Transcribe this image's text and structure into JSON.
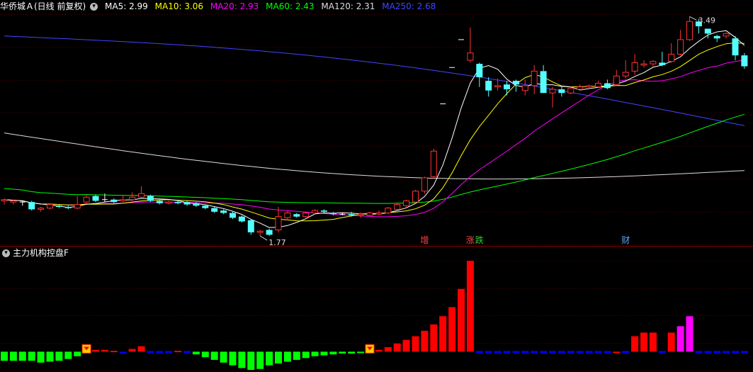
{
  "header": {
    "title": "华侨城Ａ(日线 前复权)",
    "ma": [
      {
        "label": "MA5: 2.99",
        "color": "#ffffff"
      },
      {
        "label": "MA10: 3.06",
        "color": "#ffff00"
      },
      {
        "label": "MA20: 2.93",
        "color": "#ff00ff"
      },
      {
        "label": "MA60: 2.43",
        "color": "#00ff00"
      },
      {
        "label": "MA120: 2.31",
        "color": "#dddddd"
      },
      {
        "label": "MA250: 2.68",
        "color": "#4444ff"
      }
    ]
  },
  "indicator": {
    "title": "主力机构控盘F"
  },
  "annotations": {
    "high_label": "3.49",
    "low_label": "1.77",
    "markers": [
      {
        "text": "增",
        "color": "#ff4444",
        "index": 46
      },
      {
        "text": "涨",
        "color": "#ff4444",
        "index": 51
      },
      {
        "text": "跌",
        "color": "#33cc33",
        "index": 52
      },
      {
        "text": "财",
        "color": "#55aaff",
        "index": 68
      }
    ]
  },
  "colors": {
    "up": "#ff3232",
    "down": "#54ffff",
    "flat": "#ffffff",
    "ma5": "#ffffff",
    "ma10": "#ffff00",
    "ma20": "#ff00ff",
    "ma60": "#00ff00",
    "ma120": "#dddddd",
    "ma250": "#4444ff",
    "bar_green": "#00ff00",
    "bar_red": "#ff0000",
    "bar_blue": "#0000ff",
    "bar_magenta": "#ff00ff",
    "grid": "#5a0000"
  },
  "chart_data": {
    "type": "candlestick",
    "price_range": [
      1.7,
      3.6
    ],
    "candles": [
      [
        2.06,
        2.07,
        2.03,
        2.08
      ],
      [
        2.05,
        2.06,
        2.03,
        2.07
      ],
      [
        2.05,
        2.05,
        2.02,
        2.06
      ],
      [
        2.05,
        1.99,
        1.98,
        2.06
      ],
      [
        1.99,
        2.0,
        1.97,
        2.01
      ],
      [
        2.0,
        2.03,
        1.99,
        2.04
      ],
      [
        2.02,
        2.01,
        2.0,
        2.03
      ],
      [
        2.01,
        2.0,
        1.99,
        2.02
      ],
      [
        2.0,
        2.03,
        1.99,
        2.1
      ],
      [
        2.05,
        2.09,
        2.04,
        2.11
      ],
      [
        2.1,
        2.06,
        2.05,
        2.11
      ],
      [
        2.07,
        2.07,
        2.05,
        2.12
      ],
      [
        2.07,
        2.05,
        2.04,
        2.08
      ],
      [
        2.06,
        2.07,
        2.05,
        2.11
      ],
      [
        2.07,
        2.09,
        2.06,
        2.13
      ],
      [
        2.09,
        2.12,
        2.08,
        2.18
      ],
      [
        2.1,
        2.06,
        2.05,
        2.11
      ],
      [
        2.06,
        2.04,
        2.03,
        2.07
      ],
      [
        2.04,
        2.05,
        2.03,
        2.06
      ],
      [
        2.05,
        2.04,
        2.03,
        2.07
      ],
      [
        2.05,
        2.03,
        2.02,
        2.06
      ],
      [
        2.04,
        2.02,
        2.01,
        2.05
      ],
      [
        2.02,
        2.0,
        1.99,
        2.03
      ],
      [
        2.0,
        1.97,
        1.96,
        2.01
      ],
      [
        1.98,
        1.96,
        1.95,
        1.99
      ],
      [
        1.96,
        1.92,
        1.91,
        1.97
      ],
      [
        1.93,
        1.89,
        1.88,
        1.94
      ],
      [
        1.9,
        1.8,
        1.78,
        1.91
      ],
      [
        1.8,
        1.81,
        1.77,
        1.82
      ],
      [
        1.82,
        1.78,
        1.77,
        1.83
      ],
      [
        1.82,
        1.93,
        1.8,
        2.01
      ],
      [
        1.92,
        1.96,
        1.9,
        1.98
      ],
      [
        1.95,
        1.93,
        1.92,
        1.96
      ],
      [
        1.93,
        1.96,
        1.92,
        1.97
      ],
      [
        1.96,
        1.98,
        1.95,
        1.99
      ],
      [
        1.98,
        1.97,
        1.96,
        1.99
      ],
      [
        1.96,
        1.95,
        1.94,
        1.97
      ],
      [
        1.95,
        1.95,
        1.94,
        1.96
      ],
      [
        1.95,
        1.94,
        1.93,
        1.97
      ],
      [
        1.94,
        1.95,
        1.92,
        1.96
      ],
      [
        1.94,
        1.96,
        1.93,
        1.97
      ],
      [
        1.95,
        1.96,
        1.94,
        1.98
      ],
      [
        1.96,
        2.0,
        1.95,
        2.01
      ],
      [
        1.99,
        2.03,
        1.98,
        2.04
      ],
      [
        2.02,
        2.06,
        2.01,
        2.07
      ],
      [
        2.05,
        2.14,
        2.04,
        2.15
      ],
      [
        2.14,
        2.25,
        2.12,
        2.26
      ],
      [
        2.26,
        2.47,
        2.24,
        2.49
      ],
      [
        2.86,
        2.86,
        2.86,
        2.86
      ],
      [
        3.16,
        3.16,
        3.16,
        3.16
      ],
      [
        3.39,
        3.39,
        3.39,
        3.39
      ],
      [
        3.22,
        3.28,
        3.2,
        3.49
      ],
      [
        3.19,
        3.08,
        3.0,
        3.2
      ],
      [
        3.05,
        2.97,
        2.92,
        3.08
      ],
      [
        3.0,
        3.01,
        2.97,
        3.07
      ],
      [
        3.02,
        2.98,
        2.93,
        3.05
      ],
      [
        3.05,
        3.02,
        2.96,
        3.06
      ],
      [
        2.97,
        3.01,
        2.93,
        3.06
      ],
      [
        3.01,
        3.13,
        2.94,
        3.18
      ],
      [
        3.13,
        2.95,
        2.95,
        3.18
      ],
      [
        2.95,
        2.98,
        2.83,
        3.0
      ],
      [
        2.98,
        2.95,
        2.92,
        3.01
      ],
      [
        2.95,
        2.99,
        2.94,
        3.0
      ],
      [
        2.98,
        3.0,
        2.97,
        3.02
      ],
      [
        3.0,
        3.01,
        2.98,
        3.02
      ],
      [
        3.0,
        3.03,
        2.99,
        3.05
      ],
      [
        3.03,
        2.99,
        2.98,
        3.06
      ],
      [
        3.02,
        3.09,
        3.01,
        3.14
      ],
      [
        3.09,
        3.12,
        3.07,
        3.22
      ],
      [
        3.13,
        3.2,
        3.1,
        3.27
      ],
      [
        3.18,
        3.19,
        3.16,
        3.22
      ],
      [
        3.19,
        3.21,
        3.17,
        3.22
      ],
      [
        3.2,
        3.18,
        3.17,
        3.29
      ],
      [
        3.21,
        3.27,
        3.2,
        3.36
      ],
      [
        3.27,
        3.39,
        3.26,
        3.47
      ],
      [
        3.39,
        3.54,
        3.38,
        3.58
      ],
      [
        3.54,
        3.5,
        3.44,
        3.56
      ],
      [
        3.48,
        3.44,
        3.4,
        3.47
      ],
      [
        3.42,
        3.4,
        3.37,
        3.43
      ],
      [
        3.42,
        3.44,
        3.4,
        3.45
      ],
      [
        3.4,
        3.26,
        3.22,
        3.42
      ],
      [
        3.26,
        3.17,
        3.15,
        3.28
      ]
    ],
    "ma_start_values": {
      "ma120": 2.62,
      "ma250": 3.42
    },
    "ma_end_values": {
      "ma5": 2.99,
      "ma10": 3.06,
      "ma20": 2.93,
      "ma60": 2.43,
      "ma120": 2.31,
      "ma250": 2.68
    },
    "indicator_range": [
      -2.0,
      10.0
    ],
    "indicator_values": [
      -1.0,
      -1.0,
      -1.0,
      -1.0,
      -1.2,
      -1.1,
      -1.0,
      -0.8,
      -0.5,
      0.2,
      0.2,
      0.2,
      0.1,
      -0.2,
      0.3,
      0.6,
      0,
      0,
      0,
      0.1,
      -0.1,
      -0.3,
      -0.6,
      -0.9,
      -1.2,
      -1.5,
      -1.8,
      -2.0,
      -1.9,
      -1.5,
      -1.3,
      -1.1,
      -0.9,
      -0.7,
      -0.5,
      -0.4,
      -0.3,
      -0.2,
      -0.2,
      -0.1,
      0.1,
      0.2,
      0.5,
      0.9,
      1.3,
      1.7,
      2.3,
      3.0,
      3.9,
      4.9,
      6.9,
      10.0,
      0,
      0,
      0,
      0,
      0,
      0,
      0,
      0,
      0,
      0,
      0,
      0,
      0,
      0,
      0,
      0,
      0,
      1.7,
      2.1,
      2.1,
      0,
      2.1,
      2.8,
      3.9,
      0,
      0,
      0,
      0,
      0,
      0
    ],
    "indicator_colors": [
      "g",
      "g",
      "g",
      "g",
      "g",
      "g",
      "g",
      "g",
      "g",
      "r",
      "r",
      "r",
      "r",
      "b",
      "r",
      "r",
      "b",
      "b",
      "b",
      "r",
      "b",
      "g",
      "g",
      "g",
      "g",
      "g",
      "g",
      "g",
      "g",
      "g",
      "g",
      "g",
      "g",
      "g",
      "g",
      "g",
      "g",
      "g",
      "g",
      "g",
      "r",
      "r",
      "r",
      "r",
      "r",
      "r",
      "r",
      "r",
      "r",
      "r",
      "r",
      "r",
      "b",
      "b",
      "b",
      "b",
      "b",
      "b",
      "b",
      "b",
      "b",
      "b",
      "b",
      "b",
      "b",
      "b",
      "b",
      "r",
      "b",
      "r",
      "r",
      "r",
      "b",
      "r",
      "m",
      "m",
      "b",
      "b",
      "b",
      "b",
      "b",
      "b"
    ]
  }
}
